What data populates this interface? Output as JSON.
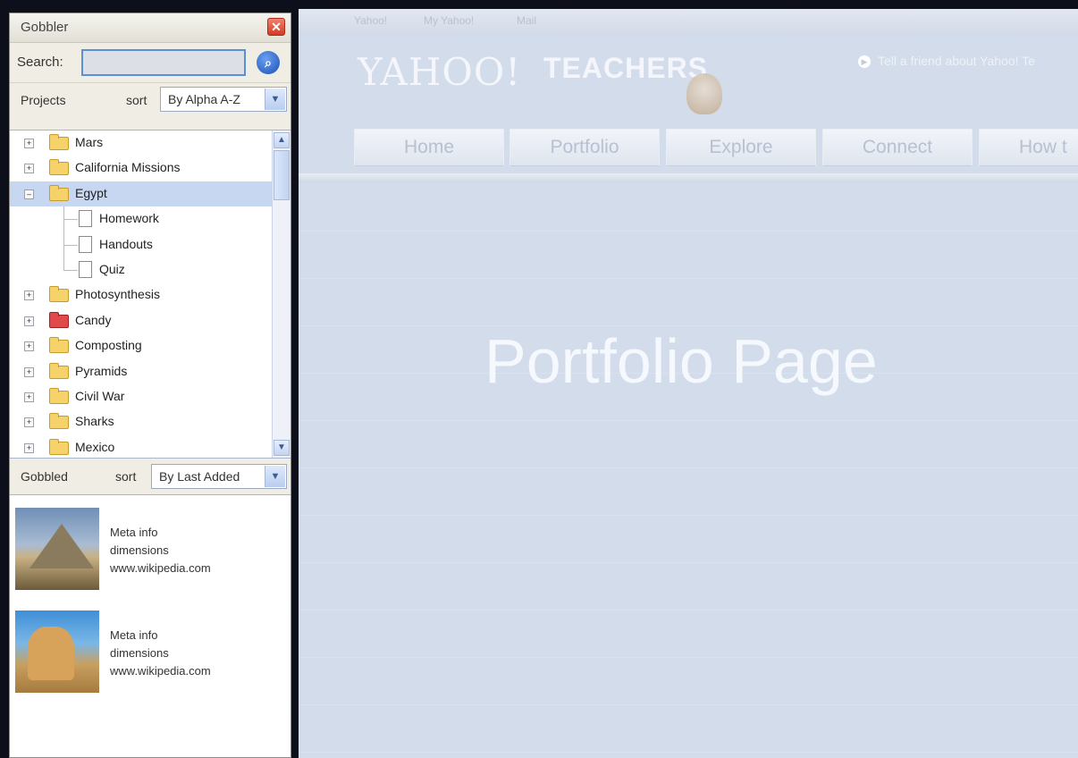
{
  "gobbler": {
    "title": "Gobbler",
    "close_icon": "close-icon",
    "search_label": "Search:",
    "search_value": "",
    "search_icon": "magnifier-icon",
    "projects_label": "Projects",
    "sort_label": "sort",
    "projects_sort_value": "By Alpha A-Z",
    "tree": [
      {
        "label": "Mars",
        "type": "folder",
        "state": "collapsed"
      },
      {
        "label": "California Missions",
        "type": "folder",
        "state": "collapsed"
      },
      {
        "label": "Egypt",
        "type": "folder",
        "state": "expanded",
        "selected": true
      },
      {
        "label": "Homework",
        "type": "file",
        "child": true
      },
      {
        "label": "Handouts",
        "type": "file",
        "child": true
      },
      {
        "label": "Quiz",
        "type": "file",
        "child": true
      },
      {
        "label": "Photosynthesis",
        "type": "folder",
        "state": "collapsed"
      },
      {
        "label": "Candy",
        "type": "folder",
        "state": "collapsed",
        "color": "#e04a4a"
      },
      {
        "label": "Composting",
        "type": "folder",
        "state": "collapsed"
      },
      {
        "label": "Pyramids",
        "type": "folder",
        "state": "collapsed"
      },
      {
        "label": "Civil War",
        "type": "folder",
        "state": "collapsed"
      },
      {
        "label": "Sharks",
        "type": "folder",
        "state": "collapsed"
      },
      {
        "label": "Mexico",
        "type": "folder",
        "state": "collapsed"
      }
    ],
    "gobbled_label": "Gobbled",
    "gobbled_sort_label": "sort",
    "gobbled_sort_value": "By Last Added",
    "gobbled_items": [
      {
        "thumb": "pyramid-sphinx-photo",
        "meta": "Meta info",
        "dims": "dimensions",
        "source": "www.wikipedia.com"
      },
      {
        "thumb": "sphinx-photo",
        "meta": "Meta info",
        "dims": "dimensions",
        "source": "www.wikipedia.com"
      }
    ]
  },
  "main": {
    "top_links": [
      "Yahoo!",
      "My Yahoo!",
      "Mail"
    ],
    "brand": "YAHOO!",
    "brand_sub": "TEACHERS",
    "tell_friend": "Tell a friend about Yahoo! Te",
    "tabs": [
      "Home",
      "Portfolio",
      "Explore",
      "Connect",
      "How t"
    ],
    "page_heading": "Portfolio Page"
  },
  "colors": {
    "accent": "#5b8fd6",
    "selection": "#c7d7f2",
    "background": "#d3dceb"
  }
}
